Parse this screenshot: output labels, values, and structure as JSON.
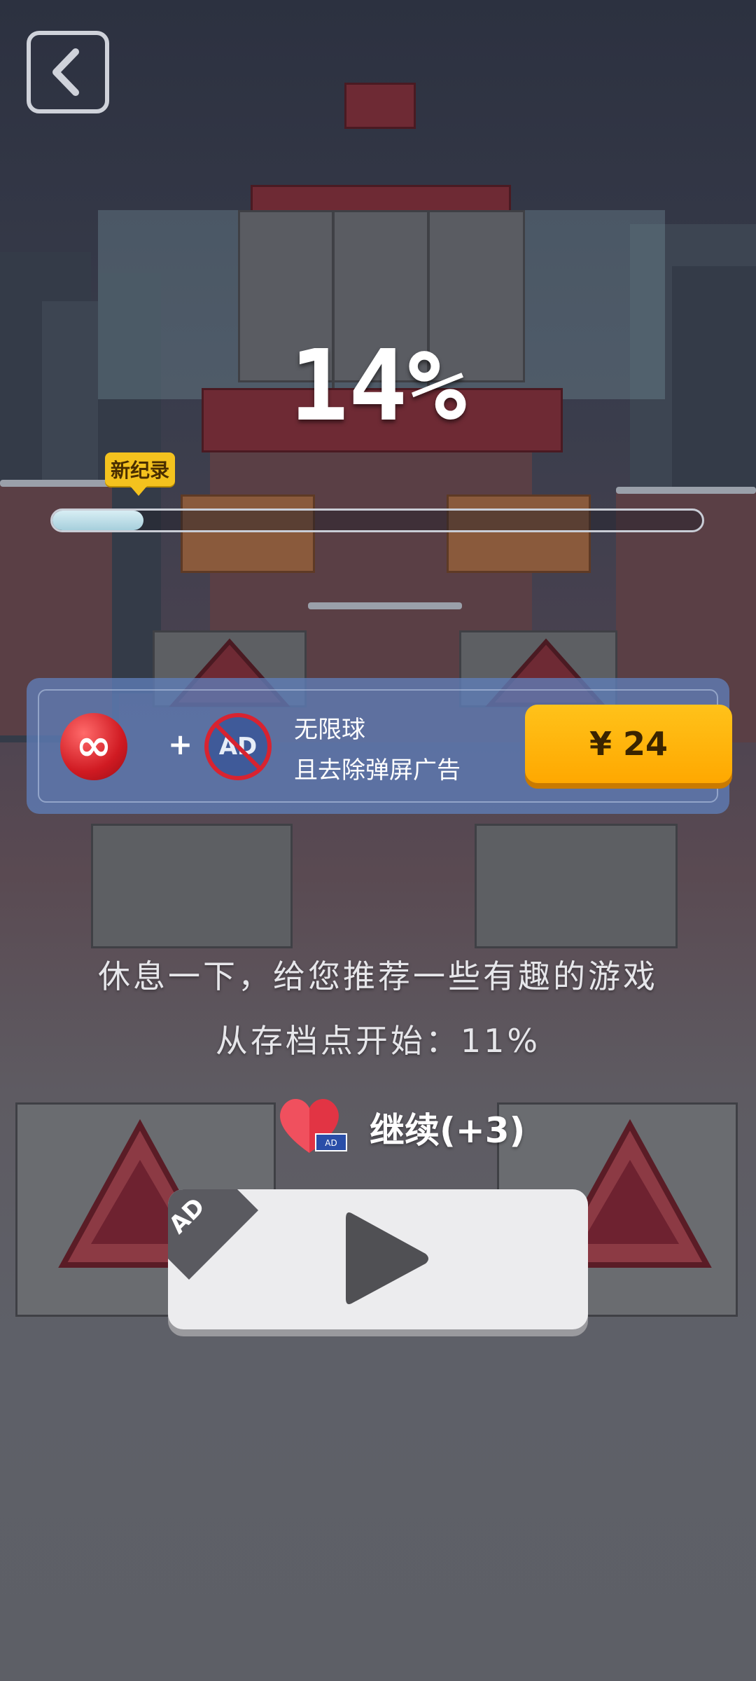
{
  "game": {
    "progress_text": "14%",
    "progress_fraction": 0.14,
    "record_badge": "新纪录",
    "back_icon": "chevron-left-icon"
  },
  "promo": {
    "title": "无限球",
    "subtitle": "且去除弹屏广告",
    "plus_sign": "+",
    "ad_icon_text": "AD",
    "infinity_symbol": "∞",
    "price": "¥ 24",
    "accent": "#ffb400"
  },
  "rest_message": "休息一下，给您推荐一些有趣的游戏",
  "checkpoint_message": "从存档点开始：11%",
  "continue": {
    "label": "继续(+3)",
    "mini_ad_text": "AD"
  },
  "video_button": {
    "corner_label": "AD",
    "icon": "play-icon"
  }
}
